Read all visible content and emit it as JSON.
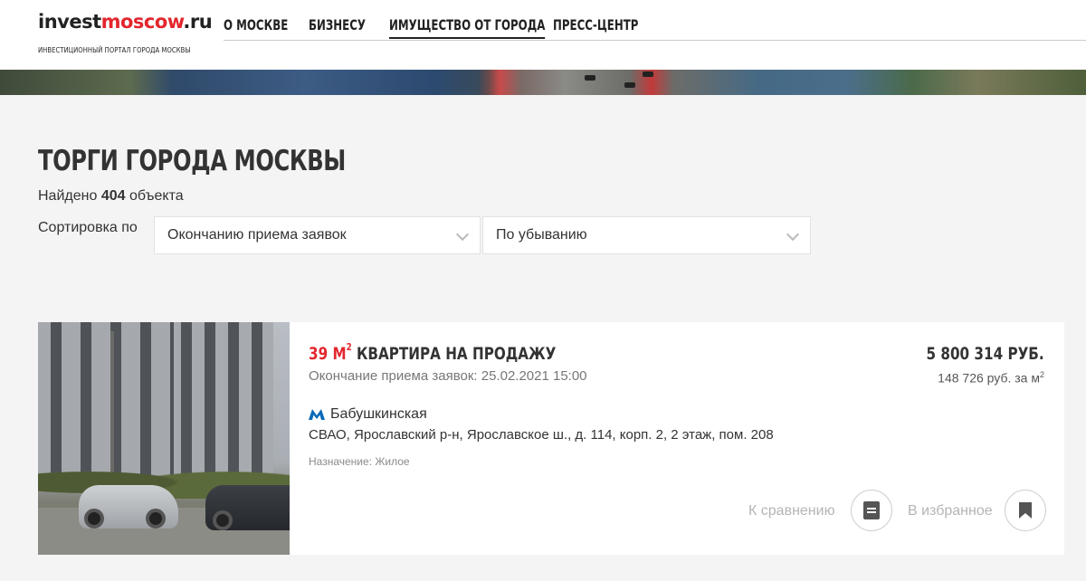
{
  "header": {
    "logo_invest": "invest",
    "logo_moscow": "moscow",
    "logo_ru": ".ru",
    "logo_subtitle": "ИНВЕСТИЦИОННЫЙ ПОРТАЛ ГОРОДА МОСКВЫ",
    "nav": [
      {
        "label": "О МОСКВЕ"
      },
      {
        "label": "БИЗНЕСУ"
      },
      {
        "label": "ИМУЩЕСТВО ОТ ГОРОДА",
        "active": true
      },
      {
        "label": "ПРЕСС-ЦЕНТР"
      }
    ]
  },
  "page": {
    "title": "ТОРГИ ГОРОДА МОСКВЫ",
    "found_prefix": "Найдено",
    "found_count": "404",
    "found_suffix": "объекта",
    "sort_label": "Сортировка по",
    "sort_field": "Окончанию приема заявок",
    "sort_order": "По убыванию"
  },
  "listing": {
    "area": "39 М",
    "area_sup": "2",
    "title": "КВАРТИРА НА ПРОДАЖУ",
    "deadline": "Окончание приема заявок: 25.02.2021 15:00",
    "metro": "Бабушкинская",
    "address": "СВАО, Ярославский р-н, Ярославское ш., д. 114, корп. 2, 2 этаж, пом. 208",
    "purpose": "Назначение: Жилое",
    "price": "5 800 314 РУБ.",
    "price_per_m": "148 726 руб. за м",
    "price_per_m_sup": "2",
    "compare_label": "К сравнению",
    "favorite_label": "В избранное"
  },
  "colors": {
    "accent": "#e3262e",
    "metro": "#0a6ab8",
    "background": "#f4f4f4"
  },
  "icons": {
    "metro": "metro-m-icon",
    "compare": "compare-list-icon",
    "favorite": "bookmark-icon"
  }
}
